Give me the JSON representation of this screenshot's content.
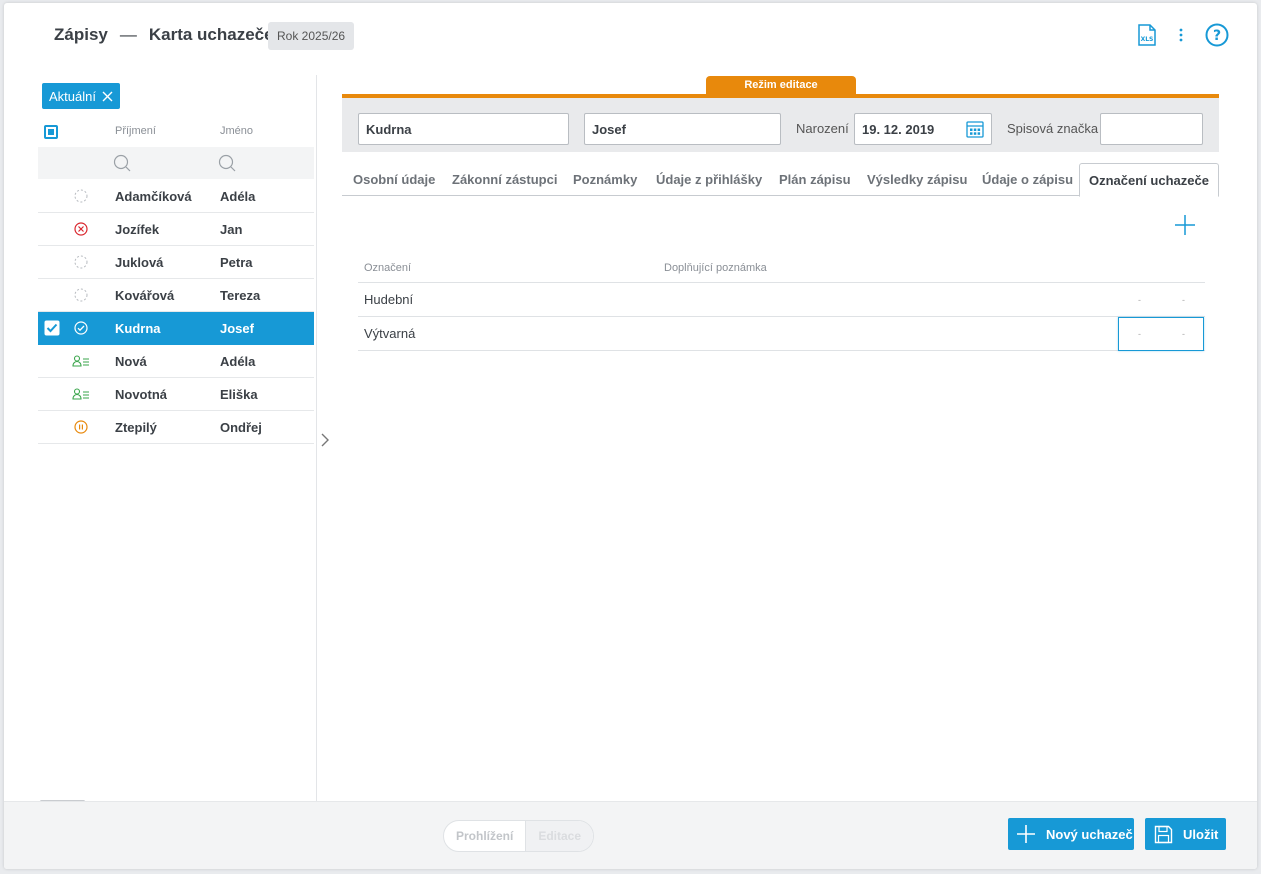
{
  "header": {
    "app": "Zápisy",
    "separator": "—",
    "page": "Karta uchazeče",
    "year": "Rok 2025/26",
    "xls_icon_text": "XLS",
    "help_icon_text": "?"
  },
  "filter_chip": {
    "label": "Aktuální"
  },
  "list": {
    "columns": {
      "surname": "Příjmení",
      "firstname": "Jméno"
    },
    "rows": [
      {
        "surname": "Adamčíková",
        "firstname": "Adéla",
        "status": "pending-icon"
      },
      {
        "surname": "Jozífek",
        "firstname": "Jan",
        "status": "rejected-icon"
      },
      {
        "surname": "Juklová",
        "firstname": "Petra",
        "status": "pending-icon"
      },
      {
        "surname": "Kovářová",
        "firstname": "Tereza",
        "status": "pending-icon"
      },
      {
        "surname": "Kudrna",
        "firstname": "Josef",
        "status": "accepted-icon",
        "selected": true
      },
      {
        "surname": "Nová",
        "firstname": "Adéla",
        "status": "enrolled-icon"
      },
      {
        "surname": "Novotná",
        "firstname": "Eliška",
        "status": "enrolled-icon"
      },
      {
        "surname": "Ztepilý",
        "firstname": "Ondřej",
        "status": "paused-icon"
      }
    ]
  },
  "edit_mode": {
    "label": "Režim editace"
  },
  "form": {
    "surname": "Kudrna",
    "firstname": "Josef",
    "birth_label": "Narození",
    "birth_value": "19. 12. 2019",
    "file_label": "Spisová značka",
    "file_value": ""
  },
  "tabs": [
    "Osobní údaje",
    "Zákonní zástupci",
    "Poznámky",
    "Údaje z přihlášky",
    "Plán zápisu",
    "Výsledky zápisu",
    "Údaje o zápisu",
    "Označení uchazeče"
  ],
  "active_tab": "Označení uchazeče",
  "table": {
    "col1": "Označení",
    "col2": "Doplňující poznámka",
    "rows": [
      {
        "label": "Hudební",
        "note": "",
        "d1": "-",
        "d2": "-"
      },
      {
        "label": "Výtvarná",
        "note": "",
        "d1": "-",
        "d2": "-"
      }
    ]
  },
  "footer": {
    "view_mode": "Prohlížení",
    "edit_mode": "Editace",
    "new_button": "Nový uchazeč",
    "save_button": "Uložit"
  },
  "colors": {
    "accent": "#1799d6",
    "edit_orange": "#e8890c"
  }
}
